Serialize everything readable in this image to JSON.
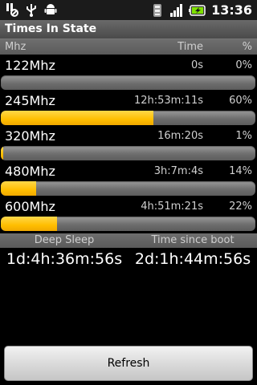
{
  "status_bar": {
    "time": "13:36",
    "left_icons": [
      "usb-debugging-icon",
      "usb-icon",
      "android-icon"
    ],
    "right_icons": [
      "wifi-icon",
      "signal-icon",
      "battery-charging-icon"
    ]
  },
  "app": {
    "title": "Times In State"
  },
  "header": {
    "mhz": "Mhz",
    "time": "Time",
    "percent": "%"
  },
  "states": [
    {
      "freq": "122Mhz",
      "time": "0s",
      "percent": "0%",
      "fraction": 0.0
    },
    {
      "freq": "245Mhz",
      "time": "12h:53m:11s",
      "percent": "60%",
      "fraction": 0.6
    },
    {
      "freq": "320Mhz",
      "time": "16m:20s",
      "percent": "1%",
      "fraction": 0.01
    },
    {
      "freq": "480Mhz",
      "time": "3h:7m:4s",
      "percent": "14%",
      "fraction": 0.14
    },
    {
      "freq": "600Mhz",
      "time": "4h:51m:21s",
      "percent": "22%",
      "fraction": 0.22
    }
  ],
  "totals": {
    "deep_sleep_label": "Deep Sleep",
    "since_boot_label": "Time since boot",
    "deep_sleep_value": "1d:4h:36m:56s",
    "since_boot_value": "2d:1h:44m:56s"
  },
  "refresh_label": "Refresh",
  "colors": {
    "bar_fill": "#ffbe00",
    "bar_track": "#6e6e6e",
    "background": "#000000"
  }
}
